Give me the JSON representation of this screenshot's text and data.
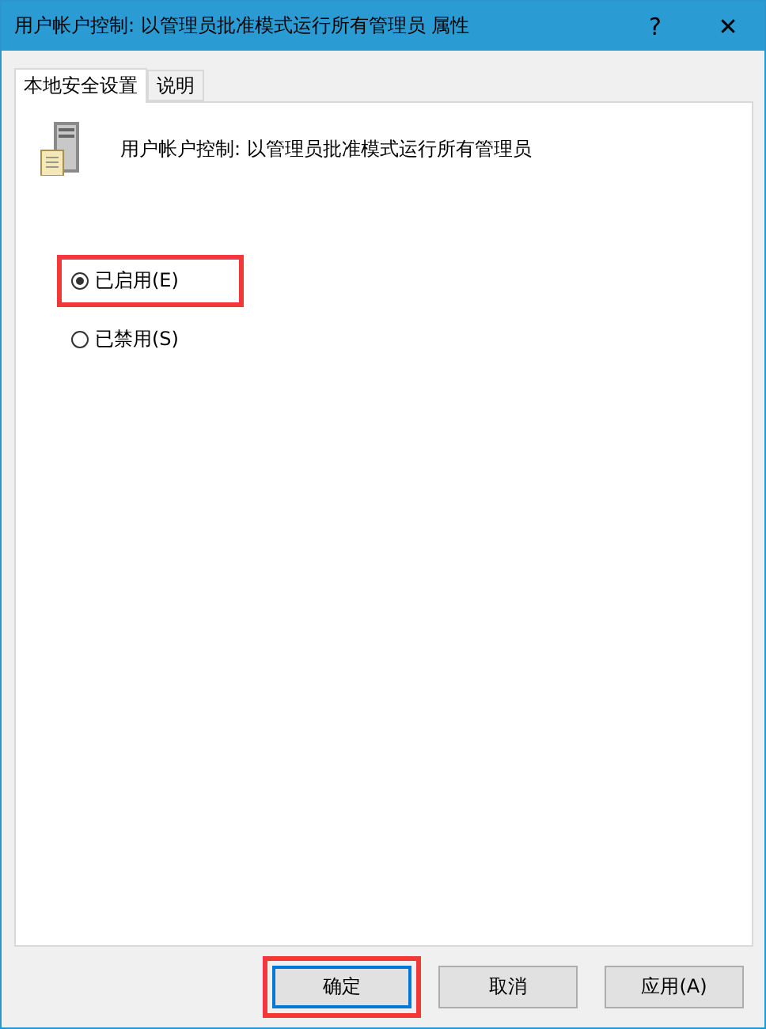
{
  "window": {
    "title": "用户帐户控制: 以管理员批准模式运行所有管理员 属性",
    "help_button": "?",
    "close_button": "✕"
  },
  "tabs": [
    {
      "label": "本地安全设置",
      "selected": true
    },
    {
      "label": "说明",
      "selected": false
    }
  ],
  "policy": {
    "name": "用户帐户控制: 以管理员批准模式运行所有管理员"
  },
  "options": [
    {
      "label": "已启用(E)",
      "selected": true,
      "highlighted": true
    },
    {
      "label": "已禁用(S)",
      "selected": false,
      "highlighted": false
    }
  ],
  "buttons": [
    {
      "label": "确定",
      "default": true,
      "highlighted": true
    },
    {
      "label": "取消",
      "default": false,
      "highlighted": false
    },
    {
      "label": "应用(A)",
      "default": false,
      "highlighted": false
    }
  ]
}
